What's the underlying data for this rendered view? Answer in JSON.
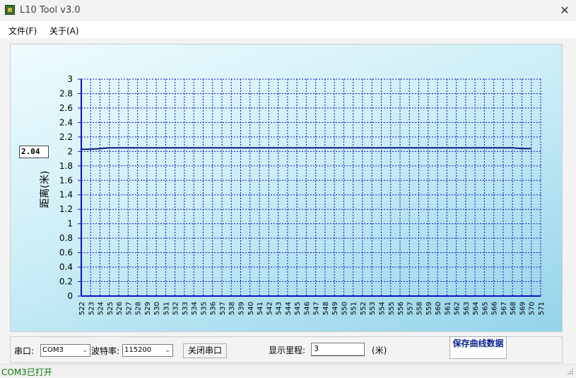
{
  "window": {
    "title": "L10 Tool v3.0",
    "close": "✕"
  },
  "menu": {
    "file": "文件(F)",
    "about": "关于(A)"
  },
  "chart": {
    "current_value": "2.04",
    "ylabel": "距离(米)"
  },
  "controls": {
    "port_label": "串口:",
    "port_value": "COM3",
    "baud_label": "波特率:",
    "baud_value": "115200",
    "close_port_button": "关闭串口",
    "range_label": "显示里程:",
    "range_value": "3",
    "range_unit": "(米)",
    "save_button": "保存曲线数据"
  },
  "status": {
    "text": "COM3已打开"
  },
  "colors": {
    "axis": "#1010c8",
    "line": "#0a1a7a",
    "grid": "#1010c8",
    "status_ok": "#0a7a0a"
  },
  "chart_data": {
    "type": "line",
    "ylabel": "距离(米)",
    "ylim": [
      0,
      3
    ],
    "xlim": [
      522,
      571
    ],
    "yticks": [
      "0",
      "0.2",
      "0.4",
      "0.6",
      "0.8",
      "1",
      "1.2",
      "1.4",
      "1.6",
      "1.8",
      "2",
      "2.2",
      "2.4",
      "2.6",
      "2.8",
      "3"
    ],
    "xticks": [
      "522",
      "523",
      "524",
      "525",
      "526",
      "527",
      "528",
      "529",
      "530",
      "531",
      "532",
      "533",
      "534",
      "535",
      "536",
      "537",
      "538",
      "539",
      "540",
      "541",
      "542",
      "543",
      "544",
      "545",
      "546",
      "547",
      "548",
      "549",
      "550",
      "551",
      "552",
      "553",
      "554",
      "555",
      "556",
      "557",
      "558",
      "559",
      "560",
      "561",
      "562",
      "563",
      "564",
      "565",
      "566",
      "567",
      "568",
      "569",
      "570",
      "571"
    ],
    "grid": true,
    "series": [
      {
        "x": [
          522,
          523,
          524,
          525,
          530,
          535,
          540,
          545,
          550,
          555,
          560,
          565,
          566,
          567,
          568,
          569,
          570
        ],
        "y": [
          2.03,
          2.03,
          2.04,
          2.05,
          2.05,
          2.05,
          2.05,
          2.05,
          2.05,
          2.05,
          2.05,
          2.05,
          2.05,
          2.05,
          2.05,
          2.04,
          2.04
        ]
      }
    ]
  }
}
